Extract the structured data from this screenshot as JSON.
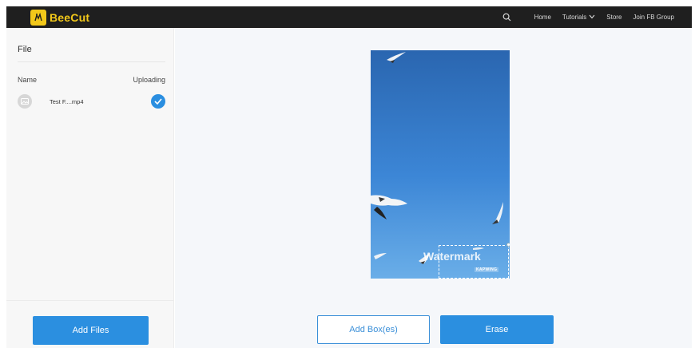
{
  "app": {
    "brand": "BeeCut",
    "brand_color": "#f2c81a",
    "accent_color": "#2b8fe0"
  },
  "nav": {
    "items": [
      {
        "label": "Home"
      },
      {
        "label": "Tutorials"
      },
      {
        "label": "Store"
      },
      {
        "label": "Join FB Group"
      }
    ]
  },
  "sidebar": {
    "title": "File",
    "columns": {
      "name": "Name",
      "status": "Uploading"
    },
    "files": [
      {
        "name": "Test F....mp4",
        "status_icon": "check-icon"
      }
    ],
    "add_files_label": "Add Files"
  },
  "preview": {
    "watermark_text": "Watermark",
    "watermark_sub": "KAPWING"
  },
  "actions": {
    "add_box_label": "Add Box(es)",
    "erase_label": "Erase"
  }
}
